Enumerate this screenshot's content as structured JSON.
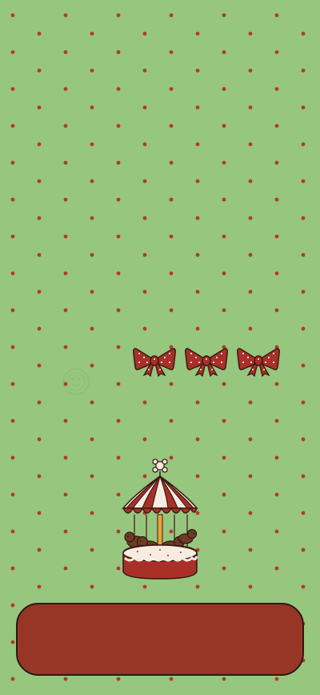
{
  "wallpaper": {
    "background_color": "#97c67e",
    "dot_color": "#b5382c"
  },
  "bows": [
    {
      "icon": "polka-dot-bow-icon",
      "color": "#a93028"
    },
    {
      "icon": "polka-dot-bow-icon",
      "color": "#a93028"
    },
    {
      "icon": "polka-dot-bow-icon",
      "color": "#a93028"
    }
  ],
  "carousel": {
    "icon": "puppy-carousel-icon",
    "canopy_colors": [
      "#a93028",
      "#f6ece1"
    ]
  },
  "dock": {
    "color": "#983626"
  },
  "watermark": {
    "icon": "faint-stamp-icon"
  }
}
